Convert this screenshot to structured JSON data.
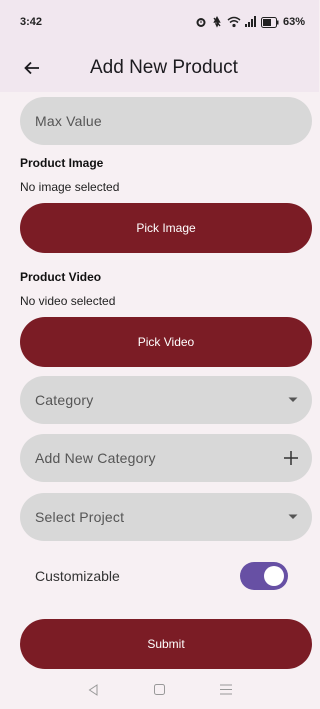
{
  "status_bar": {
    "time": "3:42",
    "battery": "63%",
    "icons": [
      "alarm-icon",
      "mute-icon",
      "wifi-icon",
      "signal-icon",
      "battery-icon"
    ]
  },
  "app_bar": {
    "title": "Add New Product",
    "back_icon": "arrow-left-icon"
  },
  "form": {
    "max_value_placeholder": "Max Value",
    "product_image": {
      "label": "Product Image",
      "status": "No image selected",
      "button": "Pick Image"
    },
    "product_video": {
      "label": "Product Video",
      "status": "No video selected",
      "button": "Pick Video"
    },
    "category": {
      "placeholder": "Category",
      "icon": "dropdown-arrow-icon"
    },
    "add_category": {
      "placeholder": "Add New Category",
      "icon": "plus-icon"
    },
    "project": {
      "placeholder": "Select Project",
      "icon": "dropdown-arrow-icon"
    },
    "customizable": {
      "label": "Customizable",
      "value": true
    },
    "submit": "Submit"
  },
  "colors": {
    "primary": "#7b1c25",
    "switch": "#6750a4",
    "field": "#d8d8d8",
    "background": "#f7f0f3"
  },
  "nav_bar": {
    "icons": [
      "back-triangle-icon",
      "home-square-icon",
      "menu-lines-icon"
    ]
  }
}
